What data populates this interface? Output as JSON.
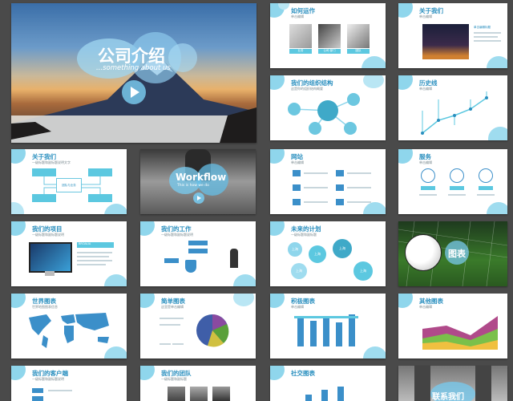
{
  "slides": {
    "cover": {
      "title": "公司介绍",
      "subtitle": "...something about us"
    },
    "s2": {
      "title": "如何运作",
      "subtitle": "单击编辑",
      "labels": [
        "业务",
        "公司·部门",
        "团队"
      ]
    },
    "s3": {
      "title": "关于我们",
      "subtitle": "单击编辑",
      "caption": "单击编辑标题"
    },
    "s4": {
      "title": "我们的组织结构",
      "subtitle": "这是你的组织结构概要"
    },
    "s5": {
      "title": "历史线",
      "subtitle": "单击编辑"
    },
    "s6": {
      "title": "关于我们",
      "subtitle": "一级标题和副标题说明文字",
      "nodes": [
        "请点击标题编辑",
        "团队与业务",
        "请点击添加文本"
      ]
    },
    "s7": {
      "title": "Workflow",
      "subtitle": "This is how we do"
    },
    "s8": {
      "title": "网站",
      "subtitle": "单击编辑"
    },
    "s9": {
      "title": "服务",
      "subtitle": "单击编辑"
    },
    "s10": {
      "title": "我们的项目",
      "subtitle": "一级标题和副标题说明",
      "tag": "BROALIA"
    },
    "s11": {
      "title": "我们的工作",
      "subtitle": "一级标题和副标题说明"
    },
    "s12": {
      "title": "未来的计划",
      "subtitle": "一级标题和副标题",
      "bubbles": [
        "上海",
        "上海",
        "上海",
        "上海",
        "上海"
      ]
    },
    "s13": {
      "title": "图表"
    },
    "s14": {
      "title": "世界图表",
      "subtitle": "世界地图图表信息"
    },
    "s15": {
      "title": "简单图表",
      "subtitle": "这里是单击编辑"
    },
    "s16": {
      "title": "积极图表",
      "subtitle": "单击编辑"
    },
    "s17": {
      "title": "其他图表",
      "subtitle": "单击编辑"
    },
    "s18": {
      "title": "我们的客户端",
      "subtitle": "一级标题和副标题说明"
    },
    "s19": {
      "title": "我们的团队",
      "subtitle": "一级标题和副标题"
    },
    "s20": {
      "title": "社交图表"
    },
    "s21": {
      "title": "联系我们"
    }
  },
  "colors": {
    "accent": "#2a8fbf",
    "bubble": "#7fd3ea",
    "box": "#5cc8e0",
    "background": "#4a4a4a"
  }
}
